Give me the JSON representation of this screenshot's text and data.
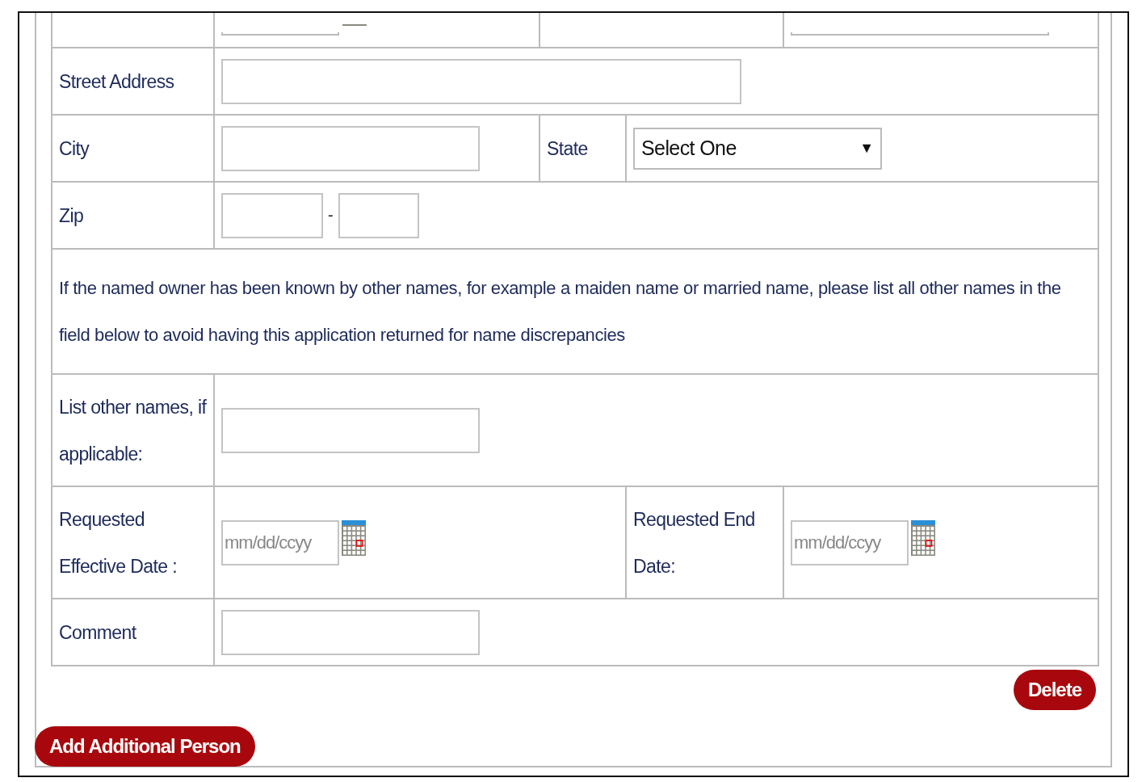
{
  "partial_row": {
    "cells": [
      {
        "kind": "empty"
      },
      {
        "kind": "date_field"
      },
      {
        "kind": "empty"
      },
      {
        "kind": "text_field"
      }
    ]
  },
  "rows": [
    {
      "kind": "wide_field",
      "label": "Street Address"
    },
    {
      "kind": "city_state",
      "label": "City",
      "state_label": "State",
      "select": {
        "value": "Select One",
        "arrow": "▼"
      }
    },
    {
      "kind": "zip",
      "label": "Zip",
      "separator": "-"
    },
    {
      "kind": "note",
      "text": "If the named owner has been known by other names, for example a maiden name or married name, please list all other names in the field below to avoid having this application returned for name discrepancies"
    },
    {
      "kind": "field",
      "label": "List other names, if applicable:"
    },
    {
      "kind": "dates",
      "label": "Requested Effective Date :",
      "placeholder": "mm/dd/ccyy",
      "end_label": "Requested End Date:",
      "end_placeholder": "mm/dd/ccyy"
    },
    {
      "kind": "field",
      "label": "Comment"
    }
  ],
  "delete_button": "Delete",
  "add_button": "Add Additional Person"
}
